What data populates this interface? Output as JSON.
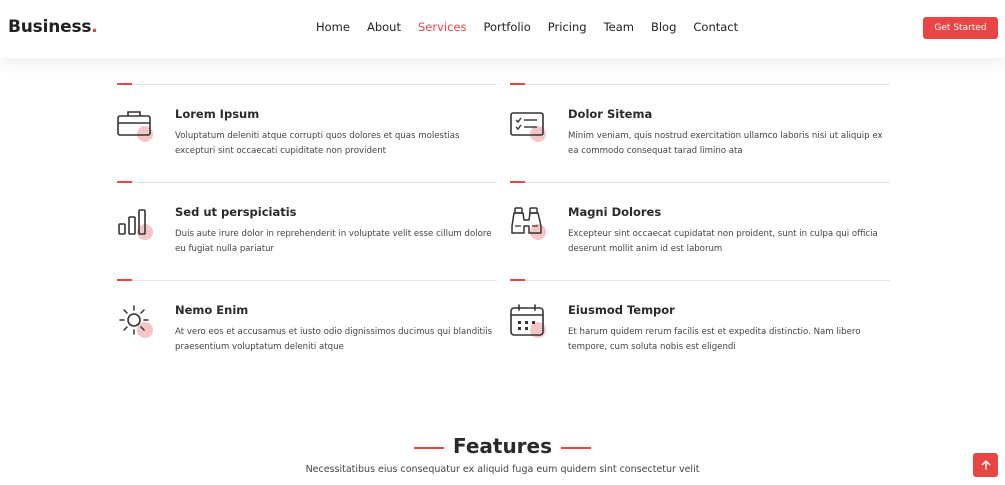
{
  "header": {
    "logo": "Business",
    "logo_dot": ".",
    "nav": [
      "Home",
      "About",
      "Services",
      "Portfolio",
      "Pricing",
      "Team",
      "Blog",
      "Contact"
    ],
    "active_nav": "Services",
    "cta_label": "Get Started"
  },
  "services": [
    {
      "icon": "briefcase-icon",
      "title": "Lorem Ipsum",
      "desc": "Voluptatum deleniti atque corrupti quos dolores et quas molestias excepturi sint occaecati cupiditate non provident"
    },
    {
      "icon": "card-checklist-icon",
      "title": "Dolor Sitema",
      "desc": "Minim veniam, quis nostrud exercitation ullamco laboris nisi ut aliquip ex ea commodo consequat tarad limino ata"
    },
    {
      "icon": "bar-chart-icon",
      "title": "Sed ut perspiciatis",
      "desc": "Duis aute irure dolor in reprehenderit in voluptate velit esse cillum dolore eu fugiat nulla pariatur"
    },
    {
      "icon": "binoculars-icon",
      "title": "Magni Dolores",
      "desc": "Excepteur sint occaecat cupidatat non proident, sunt in culpa qui officia deserunt mollit anim id est laborum"
    },
    {
      "icon": "brightness-icon",
      "title": "Nemo Enim",
      "desc": "At vero eos et accusamus et iusto odio dignissimos ducimus qui blanditiis praesentium voluptatum deleniti atque"
    },
    {
      "icon": "calendar-icon",
      "title": "Eiusmod Tempor",
      "desc": "Et harum quidem rerum facilis est et expedita distinctio. Nam libero tempore, cum soluta nobis est eligendi"
    }
  ],
  "features": {
    "title": "Features",
    "subtitle": "Necessitatibus eius consequatur ex aliquid fuga eum quidem sint consectetur velit"
  },
  "colors": {
    "accent": "#e84545",
    "blob": "#f4c6c6",
    "text": "#444444",
    "heading": "#2a2a2a"
  },
  "back_to_top_icon": "arrow-up-icon"
}
